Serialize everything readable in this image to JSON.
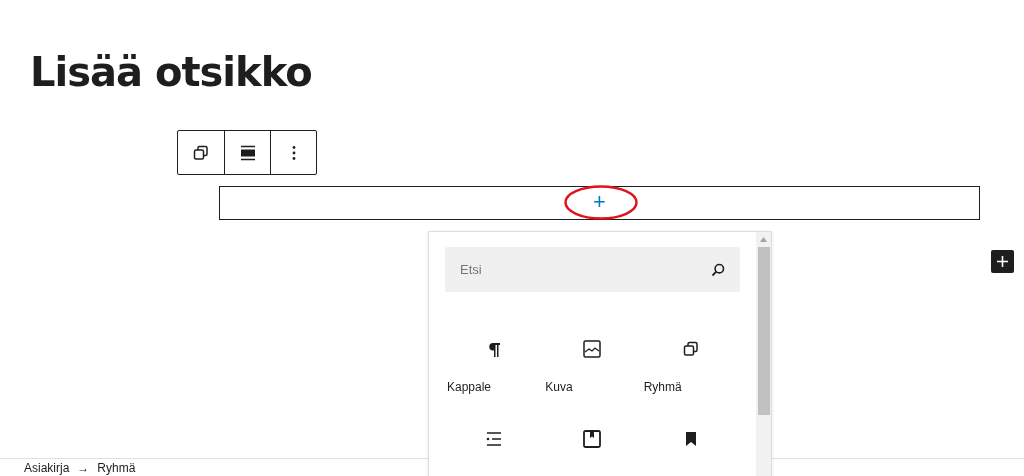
{
  "post_title": "Lisää otsikko",
  "block_toolbar": {
    "buttons": [
      {
        "kind": "group"
      },
      {
        "kind": "align"
      },
      {
        "kind": "more"
      }
    ]
  },
  "group_block": {
    "appender": "+"
  },
  "inserter": {
    "search": {
      "placeholder": "Etsi"
    },
    "blocks": [
      {
        "kind": "paragraph",
        "label": "Kappale"
      },
      {
        "kind": "image",
        "label": "Kuva"
      },
      {
        "kind": "group",
        "label": "Ryhmä"
      },
      {
        "kind": "list"
      },
      {
        "kind": "reusable"
      },
      {
        "kind": "bookmark"
      }
    ]
  },
  "breadcrumb": [
    "Asiakirja",
    "→",
    "Ryhmä"
  ]
}
